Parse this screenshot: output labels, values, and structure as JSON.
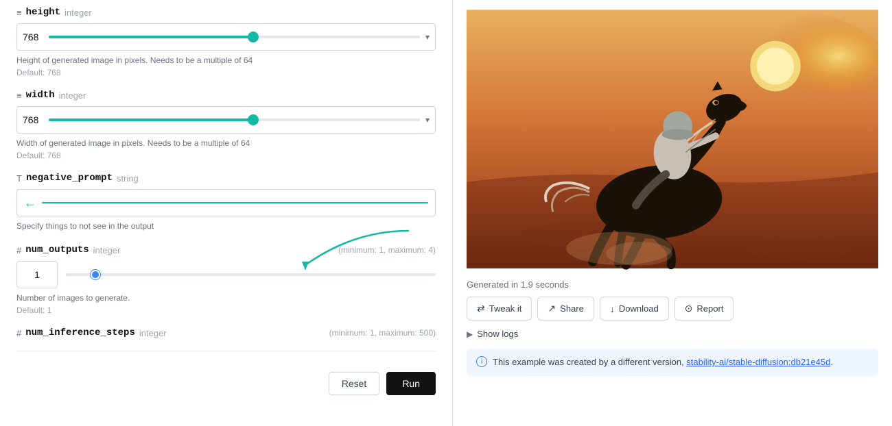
{
  "left_panel": {
    "fields": [
      {
        "id": "height",
        "icon": "≡",
        "name": "height",
        "type": "integer",
        "value": "768",
        "slider_fill_pct": 55,
        "description": "Height of generated image in pixels. Needs to be a multiple of 64",
        "default_label": "Default: 768",
        "has_chevron": true,
        "slider_color": "teal"
      },
      {
        "id": "width",
        "icon": "≡",
        "name": "width",
        "type": "integer",
        "value": "768",
        "slider_fill_pct": 55,
        "description": "Width of generated image in pixels. Needs to be a multiple of 64",
        "default_label": "Default: 768",
        "has_chevron": true,
        "slider_color": "teal"
      },
      {
        "id": "negative_prompt",
        "icon": "T",
        "name": "negative_prompt",
        "type": "string",
        "description": "Specify things to not see in the output",
        "is_text": true
      },
      {
        "id": "num_outputs",
        "icon": "#",
        "name": "num_outputs",
        "type": "integer",
        "value": "1",
        "range_hint": "(minimum: 1, maximum: 4)",
        "description": "Number of images to generate.",
        "default_label": "Default: 1",
        "slider_color": "blue",
        "is_num_outputs": true
      },
      {
        "id": "num_inference_steps",
        "icon": "#",
        "name": "num_inference_steps",
        "type": "integer",
        "range_hint": "(minimum: 1, maximum: 500)"
      }
    ],
    "buttons": {
      "reset": "Reset",
      "run": "Run"
    }
  },
  "right_panel": {
    "generated_time": "Generated in 1.9 seconds",
    "action_buttons": [
      {
        "id": "tweak",
        "icon": "⇄",
        "label": "Tweak it"
      },
      {
        "id": "share",
        "icon": "↗",
        "label": "Share"
      },
      {
        "id": "download",
        "icon": "↓",
        "label": "Download"
      },
      {
        "id": "report",
        "icon": "⊙",
        "label": "Report"
      }
    ],
    "show_logs_label": "Show logs",
    "info_text": "This example was created by a different version, ",
    "info_link_text": "stability-ai/stable-diffusion:db21e45d",
    "info_link": "#",
    "info_suffix": "."
  }
}
